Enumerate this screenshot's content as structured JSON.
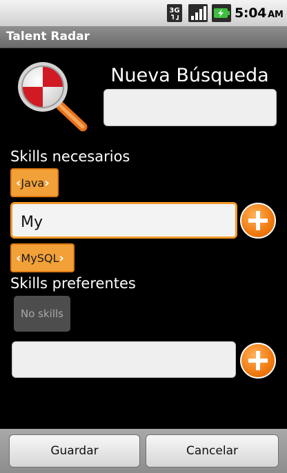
{
  "status_bar": {
    "network": "3G",
    "time": "5:04",
    "ampm": "AM",
    "icons": [
      "3g-icon",
      "signal-icon",
      "battery-icon"
    ]
  },
  "app": {
    "title": "Talent Radar"
  },
  "search": {
    "title": "Nueva Búsqueda",
    "name_value": ""
  },
  "required_skills": {
    "label": "Skills necesarios",
    "chips": [
      "Java",
      "MySQL"
    ],
    "input_value": "My"
  },
  "preferred_skills": {
    "label": "Skills preferentes",
    "empty_label": "No skills",
    "input_value": ""
  },
  "actions": {
    "save": "Guardar",
    "cancel": "Cancelar"
  },
  "colors": {
    "accent": "#f2a138",
    "accent_border": "#e07a12",
    "background": "#000000"
  }
}
